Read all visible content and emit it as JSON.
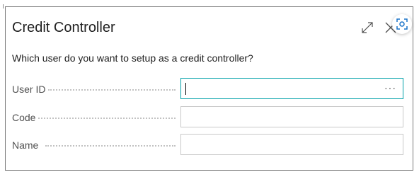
{
  "dialog": {
    "title": "Credit Controller",
    "instruction": "Which user do you want to setup as a credit controller?"
  },
  "fields": [
    {
      "label": "User ID",
      "value": "",
      "lookup_label": "···"
    },
    {
      "label": "Code",
      "value": ""
    },
    {
      "label": "Name",
      "value": ""
    }
  ],
  "icons": {
    "expand": "expand-icon",
    "close": "close-icon",
    "capture": "screen-capture-icon"
  },
  "colors": {
    "focus_border": "#00a0a8",
    "border": "#c8c8c8"
  }
}
